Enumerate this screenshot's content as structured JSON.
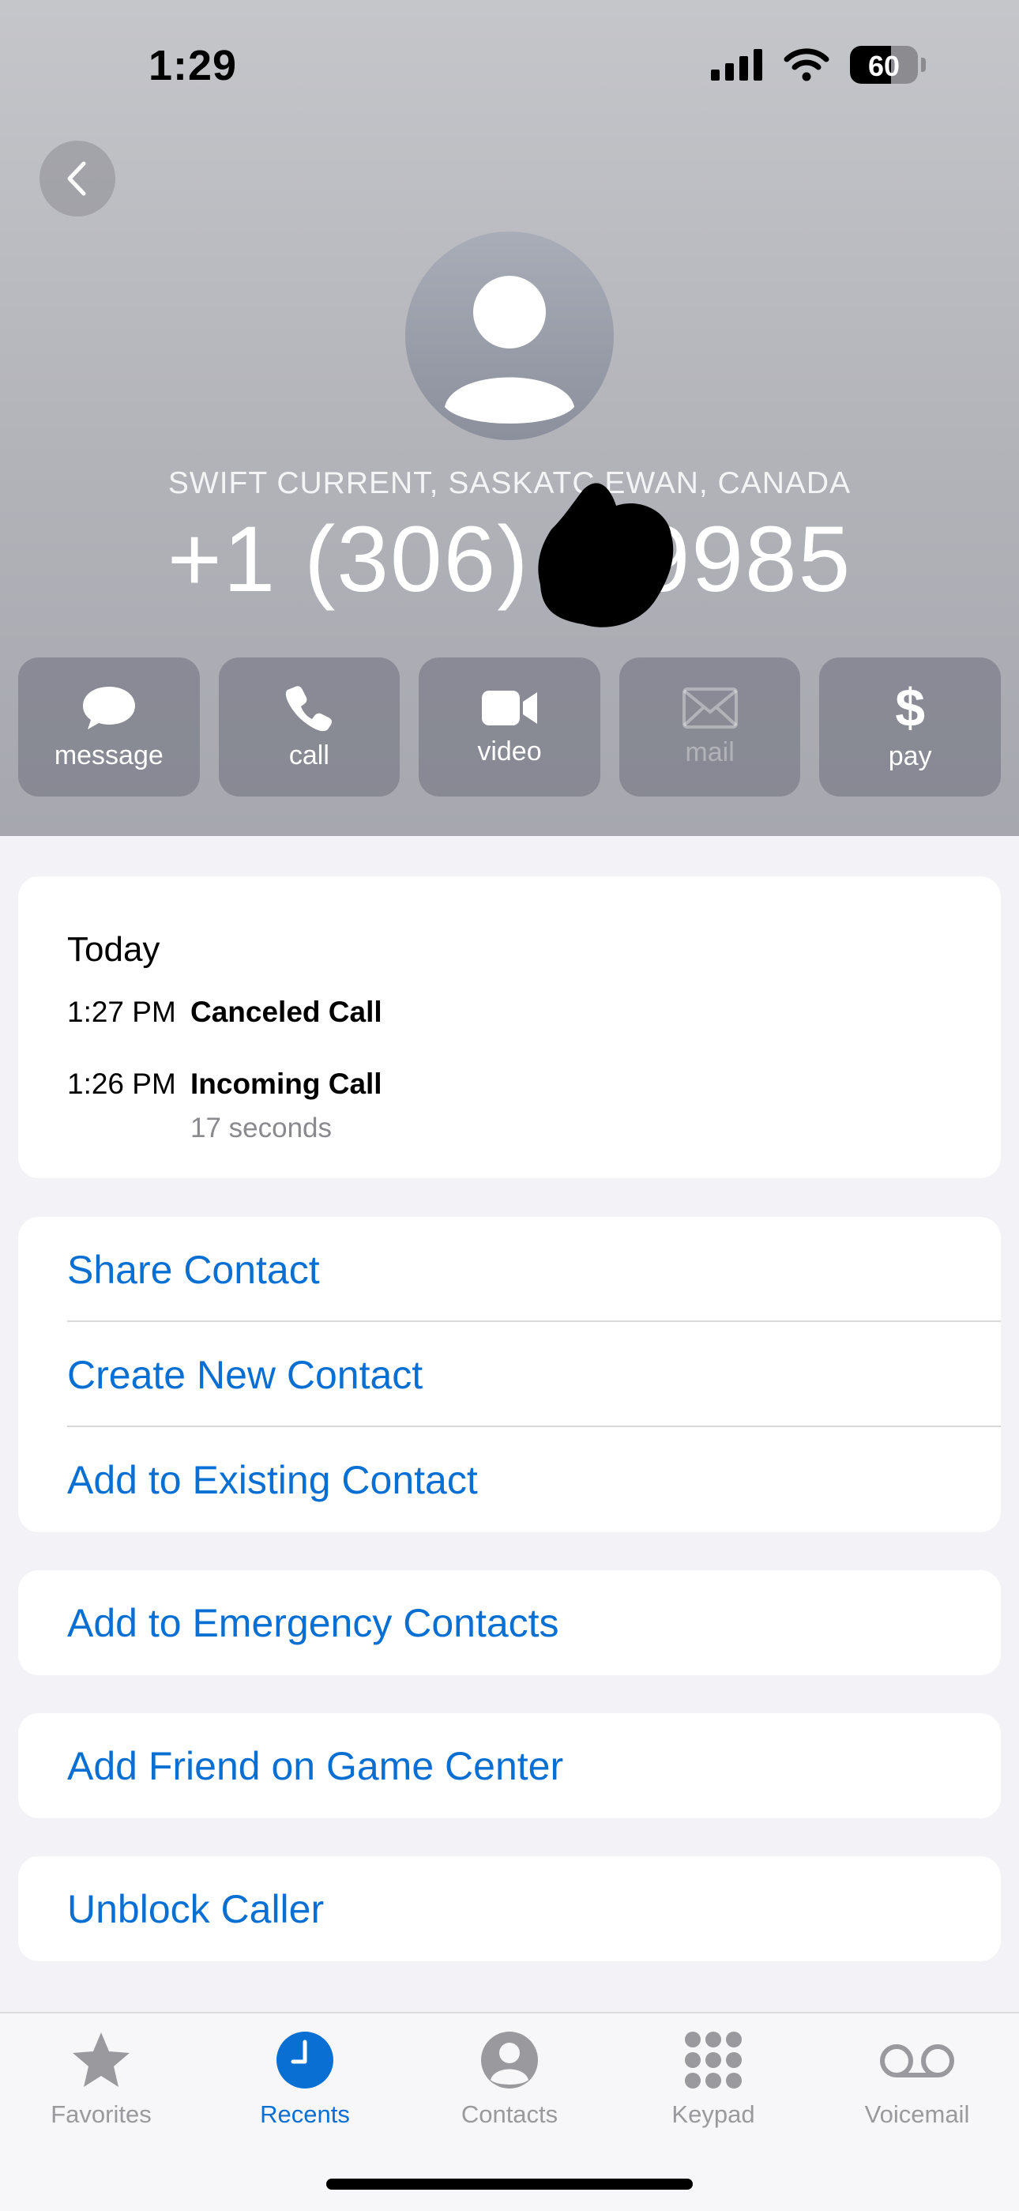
{
  "status_bar": {
    "time": "1:29",
    "battery": "60",
    "battery_level": 0.6
  },
  "contact": {
    "location": "SWIFT CURRENT, SASKATC  EWAN, CANADA",
    "phone": "+1 (306) 7      9985"
  },
  "actions": [
    {
      "label": "message",
      "icon": "message-bubble-icon",
      "enabled": true
    },
    {
      "label": "call",
      "icon": "phone-icon",
      "enabled": true
    },
    {
      "label": "video",
      "icon": "video-camera-icon",
      "enabled": true
    },
    {
      "label": "mail",
      "icon": "envelope-icon",
      "enabled": false
    },
    {
      "label": "pay",
      "icon": "dollar-icon",
      "enabled": true
    }
  ],
  "history": {
    "title": "Today",
    "calls": [
      {
        "time": "1:27 PM",
        "type": "Canceled Call",
        "duration": ""
      },
      {
        "time": "1:26 PM",
        "type": "Incoming Call",
        "duration": "17 seconds"
      }
    ]
  },
  "contact_options": [
    "Share Contact",
    "Create New Contact",
    "Add to Existing Contact"
  ],
  "emergency_option": "Add to Emergency Contacts",
  "game_center_option": "Add Friend on Game Center",
  "unblock_option": "Unblock Caller",
  "tabs": [
    {
      "label": "Favorites",
      "icon": "star-icon",
      "active": false
    },
    {
      "label": "Recents",
      "icon": "clock-icon",
      "active": true
    },
    {
      "label": "Contacts",
      "icon": "person-circle-icon",
      "active": false
    },
    {
      "label": "Keypad",
      "icon": "keypad-icon",
      "active": false
    },
    {
      "label": "Voicemail",
      "icon": "voicemail-icon",
      "active": false
    }
  ],
  "colors": {
    "accent": "#0a6fd3",
    "header_bg": "#b2b3b9",
    "page_bg": "#f2f2f7"
  }
}
